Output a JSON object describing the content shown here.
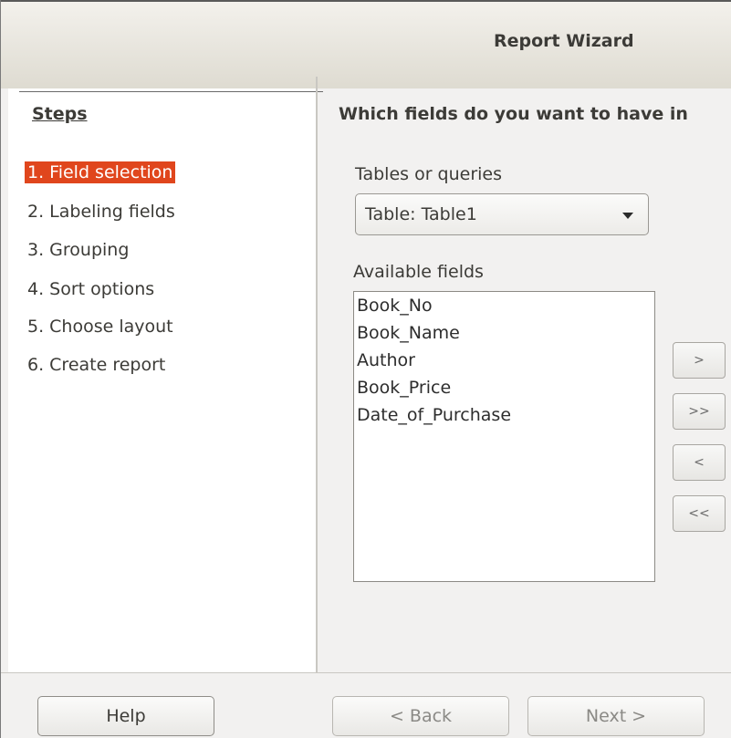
{
  "window": {
    "title": "Report Wizard"
  },
  "sidebar": {
    "heading": "Steps",
    "steps": [
      "1. Field selection",
      "2. Labeling fields",
      "3. Grouping",
      "4. Sort options",
      "5. Choose layout",
      "6. Create report"
    ],
    "active_step_index": 0
  },
  "main": {
    "question": "Which fields do you want to have in",
    "tables_label": "Tables or queries",
    "table_select_value": "Table: Table1",
    "available_label": "Available fields",
    "available_fields": [
      "Book_No",
      "Book_Name",
      "Author",
      "Book_Price",
      "Date_of_Purchase"
    ],
    "move_buttons": {
      "add_one": ">",
      "add_all": ">>",
      "remove_one": "<",
      "remove_all": "<<"
    }
  },
  "footer": {
    "help": "Help",
    "back": "< Back",
    "next": "Next >"
  },
  "colors": {
    "active_step_bg": "#e0461d",
    "titlebar": "#e8e6df"
  }
}
